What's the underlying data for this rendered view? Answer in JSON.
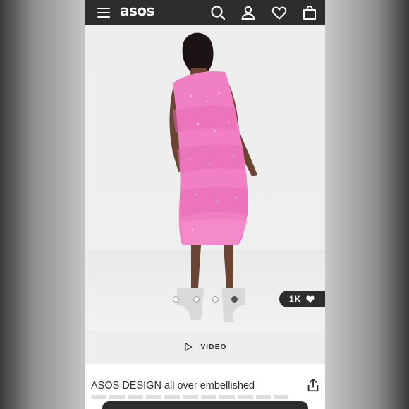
{
  "header": {
    "logo": "asos",
    "menu_icon": "menu-icon",
    "search_icon": "search-icon",
    "account_icon": "account-icon",
    "saved_icon": "heart-icon",
    "bag_icon": "bag-icon",
    "background": "#2d2d2d"
  },
  "gallery": {
    "likes": "1K",
    "likes_icon": "heart-icon",
    "image_count": 4,
    "active_index": 4,
    "dress_color": "#f07fc3"
  },
  "video": {
    "label": "VIDEO",
    "icon": "play-icon"
  },
  "product": {
    "title": "ASOS DESIGN all over embellished",
    "share_icon": "share-icon"
  }
}
